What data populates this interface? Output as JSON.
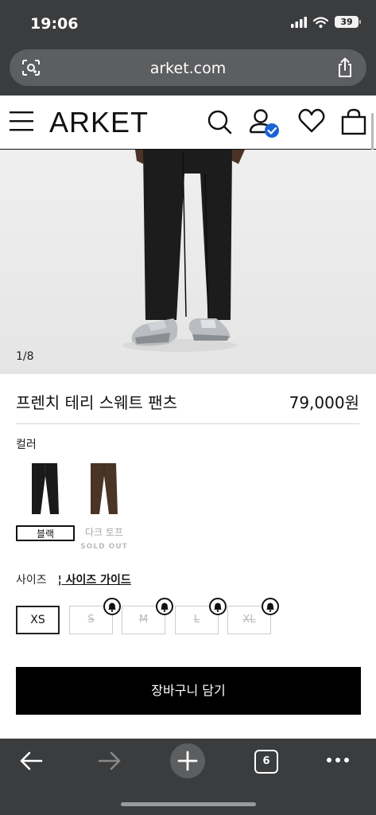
{
  "status_bar": {
    "time": "19:06",
    "battery": "39"
  },
  "browser": {
    "url": "arket.com",
    "tab_count": "6"
  },
  "site": {
    "logo": "ARKET"
  },
  "product": {
    "image_counter": "1/8",
    "title": "프렌치 테리 스웨트 팬츠",
    "price": "79,000원"
  },
  "color": {
    "label": "컬러",
    "options": [
      {
        "name": "블랙",
        "selected": true,
        "swatch_color": "#1a1a1a"
      },
      {
        "name": "다크 토프",
        "status": "SOLD OUT",
        "swatch_color": "#4a3426"
      }
    ]
  },
  "size": {
    "label": "사이즈",
    "guide": "사이즈 가이드",
    "options": [
      {
        "label": "XS",
        "selected": true
      },
      {
        "label": "S",
        "available": false
      },
      {
        "label": "M",
        "available": false
      },
      {
        "label": "L",
        "available": false
      },
      {
        "label": "XL",
        "available": false
      }
    ]
  },
  "cta": {
    "add_to_cart": "장바구니 담기"
  },
  "colors": {
    "primary": "#000000",
    "browser_chrome": "#3b3c3e",
    "account_badge": "#1a63d6"
  }
}
